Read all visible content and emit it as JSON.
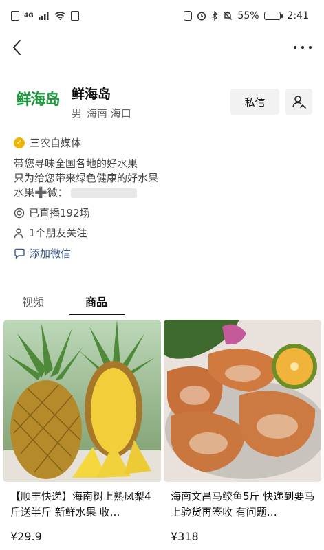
{
  "status_bar": {
    "network": "4G",
    "battery_percent": "55%",
    "battery_level": 0.55,
    "time": "2:41"
  },
  "profile": {
    "avatar_text": "鲜海岛",
    "name": "鲜海岛",
    "gender": "男",
    "location": "海南 海口",
    "message_label": "私信"
  },
  "info": {
    "verify_label": "三农自媒体",
    "bio_line1": "带您寻味全国各地的好水果",
    "bio_line2": "只为给您带来绿色健康的好水果",
    "bio_line3": "水果➕微：",
    "live_count": "已直播192场",
    "friends_follow": "1个朋友关注",
    "add_wechat": "添加微信"
  },
  "tabs": [
    {
      "label": "视频",
      "active": false
    },
    {
      "label": "商品",
      "active": true
    }
  ],
  "products": [
    {
      "title": "【顺丰快递】海南树上熟凤梨4斤送半斤 新鲜水果 收…",
      "price": "¥29.9"
    },
    {
      "title": "海南文昌马鲛鱼5斤 快递到要马上验货再签收 有问题…",
      "price": "¥318"
    }
  ],
  "icons": {
    "back": "back-arrow-icon",
    "more": "more-dots-icon",
    "follow": "add-follow-icon",
    "verify": "verified-badge-icon",
    "live": "live-broadcast-icon",
    "friends": "person-icon",
    "wechat": "chat-bubble-icon"
  },
  "colors": {
    "brand_green": "#1a9a3c",
    "verify_gold": "#f0b400",
    "link_blue": "#3a5a8a"
  }
}
